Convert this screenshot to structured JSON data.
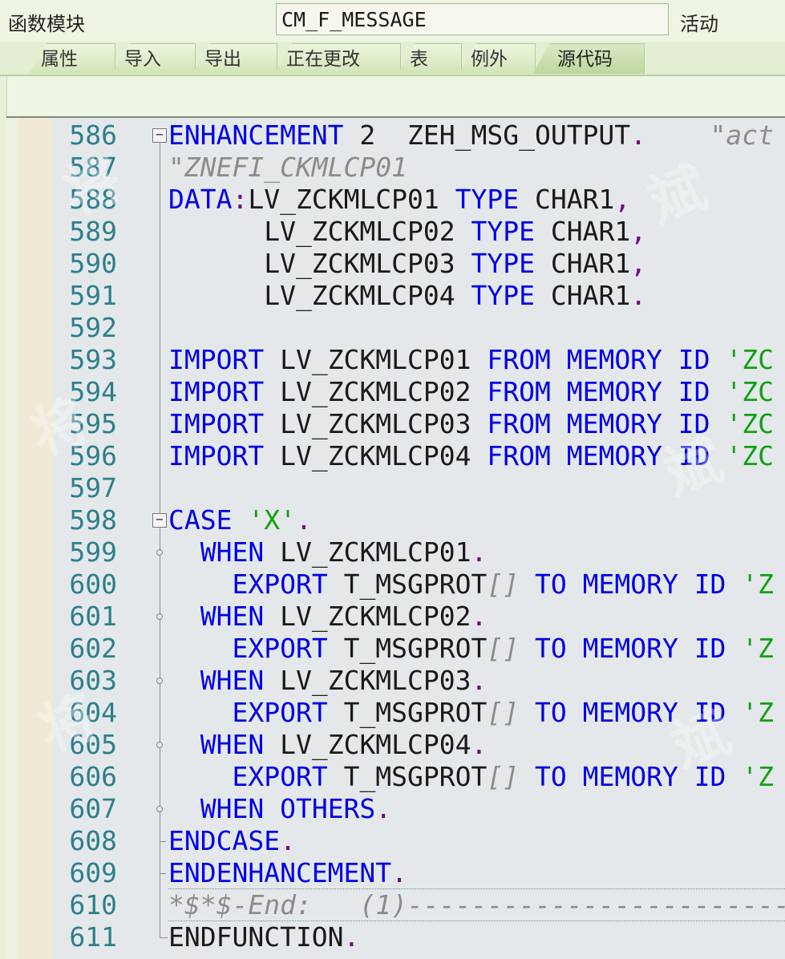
{
  "header": {
    "function_module_label": "函数模块",
    "function_module_value": "CM_F_MESSAGE",
    "status": "活动"
  },
  "tabs": [
    {
      "label": "属性",
      "active": false
    },
    {
      "label": "导入",
      "active": false
    },
    {
      "label": "导出",
      "active": false
    },
    {
      "label": "正在更改",
      "active": false
    },
    {
      "label": "表",
      "active": false
    },
    {
      "label": "例外",
      "active": false
    },
    {
      "label": "源代码",
      "active": true
    }
  ],
  "editor": {
    "colors": {
      "keyword": "#0000e6",
      "string": "#12a012",
      "comment": "#8c8c8c",
      "line_number": "#2d7f8c",
      "punct": "#7a0080"
    },
    "lines": [
      {
        "n": "586",
        "tokens": [
          [
            "k",
            "ENHANCEMENT"
          ],
          [
            "n",
            " 2  ZEH_MSG_OUTPUT"
          ],
          [
            "p",
            "."
          ],
          [
            "n",
            "    "
          ],
          [
            "c",
            "\"act"
          ]
        ]
      },
      {
        "n": "587",
        "tokens": [
          [
            "c",
            "\"ZNEFI_CKMLCP01"
          ]
        ]
      },
      {
        "n": "588",
        "tokens": [
          [
            "k",
            "DATA"
          ],
          [
            "p",
            ":"
          ],
          [
            "n",
            "LV_ZCKMLCP01 "
          ],
          [
            "k",
            "TYPE"
          ],
          [
            "n",
            " CHAR1"
          ],
          [
            "p",
            ","
          ]
        ]
      },
      {
        "n": "589",
        "tokens": [
          [
            "n",
            "      LV_ZCKMLCP02 "
          ],
          [
            "k",
            "TYPE"
          ],
          [
            "n",
            " CHAR1"
          ],
          [
            "p",
            ","
          ]
        ]
      },
      {
        "n": "590",
        "tokens": [
          [
            "n",
            "      LV_ZCKMLCP03 "
          ],
          [
            "k",
            "TYPE"
          ],
          [
            "n",
            " CHAR1"
          ],
          [
            "p",
            ","
          ]
        ]
      },
      {
        "n": "591",
        "tokens": [
          [
            "n",
            "      LV_ZCKMLCP04 "
          ],
          [
            "k",
            "TYPE"
          ],
          [
            "n",
            " CHAR1"
          ],
          [
            "p",
            "."
          ]
        ]
      },
      {
        "n": "592",
        "tokens": []
      },
      {
        "n": "593",
        "tokens": [
          [
            "k",
            "IMPORT"
          ],
          [
            "n",
            " LV_ZCKMLCP01 "
          ],
          [
            "k",
            "FROM MEMORY ID"
          ],
          [
            "s",
            " 'ZC"
          ]
        ]
      },
      {
        "n": "594",
        "tokens": [
          [
            "k",
            "IMPORT"
          ],
          [
            "n",
            " LV_ZCKMLCP02 "
          ],
          [
            "k",
            "FROM MEMORY ID"
          ],
          [
            "s",
            " 'ZC"
          ]
        ]
      },
      {
        "n": "595",
        "tokens": [
          [
            "k",
            "IMPORT"
          ],
          [
            "n",
            " LV_ZCKMLCP03 "
          ],
          [
            "k",
            "FROM MEMORY ID"
          ],
          [
            "s",
            " 'ZC"
          ]
        ]
      },
      {
        "n": "596",
        "tokens": [
          [
            "k",
            "IMPORT"
          ],
          [
            "n",
            " LV_ZCKMLCP04 "
          ],
          [
            "k",
            "FROM MEMORY ID"
          ],
          [
            "s",
            " 'ZC"
          ]
        ]
      },
      {
        "n": "597",
        "tokens": []
      },
      {
        "n": "598",
        "tokens": [
          [
            "k",
            "CASE"
          ],
          [
            "s",
            " 'X'"
          ],
          [
            "p",
            "."
          ]
        ]
      },
      {
        "n": "599",
        "tokens": [
          [
            "n",
            "  "
          ],
          [
            "k",
            "WHEN"
          ],
          [
            "n",
            " LV_ZCKMLCP01"
          ],
          [
            "p",
            "."
          ]
        ]
      },
      {
        "n": "600",
        "tokens": [
          [
            "n",
            "    "
          ],
          [
            "k",
            "EXPORT"
          ],
          [
            "n",
            " T_MSGPROT"
          ],
          [
            "c",
            "[]"
          ],
          [
            "n",
            " "
          ],
          [
            "k",
            "TO MEMORY ID"
          ],
          [
            "s",
            " 'Z"
          ]
        ]
      },
      {
        "n": "601",
        "tokens": [
          [
            "n",
            "  "
          ],
          [
            "k",
            "WHEN"
          ],
          [
            "n",
            " LV_ZCKMLCP02"
          ],
          [
            "p",
            "."
          ]
        ]
      },
      {
        "n": "602",
        "tokens": [
          [
            "n",
            "    "
          ],
          [
            "k",
            "EXPORT"
          ],
          [
            "n",
            " T_MSGPROT"
          ],
          [
            "c",
            "[]"
          ],
          [
            "n",
            " "
          ],
          [
            "k",
            "TO MEMORY ID"
          ],
          [
            "s",
            " 'Z"
          ]
        ]
      },
      {
        "n": "603",
        "tokens": [
          [
            "n",
            "  "
          ],
          [
            "k",
            "WHEN"
          ],
          [
            "n",
            " LV_ZCKMLCP03"
          ],
          [
            "p",
            "."
          ]
        ]
      },
      {
        "n": "604",
        "tokens": [
          [
            "n",
            "    "
          ],
          [
            "k",
            "EXPORT"
          ],
          [
            "n",
            " T_MSGPROT"
          ],
          [
            "c",
            "[]"
          ],
          [
            "n",
            " "
          ],
          [
            "k",
            "TO MEMORY ID"
          ],
          [
            "s",
            " 'Z"
          ]
        ]
      },
      {
        "n": "605",
        "tokens": [
          [
            "n",
            "  "
          ],
          [
            "k",
            "WHEN"
          ],
          [
            "n",
            " LV_ZCKMLCP04"
          ],
          [
            "p",
            "."
          ]
        ]
      },
      {
        "n": "606",
        "tokens": [
          [
            "n",
            "    "
          ],
          [
            "k",
            "EXPORT"
          ],
          [
            "n",
            " T_MSGPROT"
          ],
          [
            "c",
            "[]"
          ],
          [
            "n",
            " "
          ],
          [
            "k",
            "TO MEMORY ID"
          ],
          [
            "s",
            " 'Z"
          ]
        ]
      },
      {
        "n": "607",
        "tokens": [
          [
            "n",
            "  "
          ],
          [
            "k",
            "WHEN OTHERS"
          ],
          [
            "p",
            "."
          ]
        ]
      },
      {
        "n": "608",
        "tokens": [
          [
            "k",
            "ENDCASE"
          ],
          [
            "p",
            "."
          ]
        ]
      },
      {
        "n": "609",
        "tokens": [
          [
            "k",
            "ENDENHANCEMENT"
          ],
          [
            "p",
            "."
          ]
        ]
      },
      {
        "n": "610",
        "tokens": [
          [
            "c",
            "*$*$-End:   (1)---------------------------"
          ]
        ]
      },
      {
        "n": "611",
        "tokens": [
          [
            "n",
            "ENDFUNCTION"
          ],
          [
            "p",
            "."
          ]
        ]
      }
    ]
  }
}
